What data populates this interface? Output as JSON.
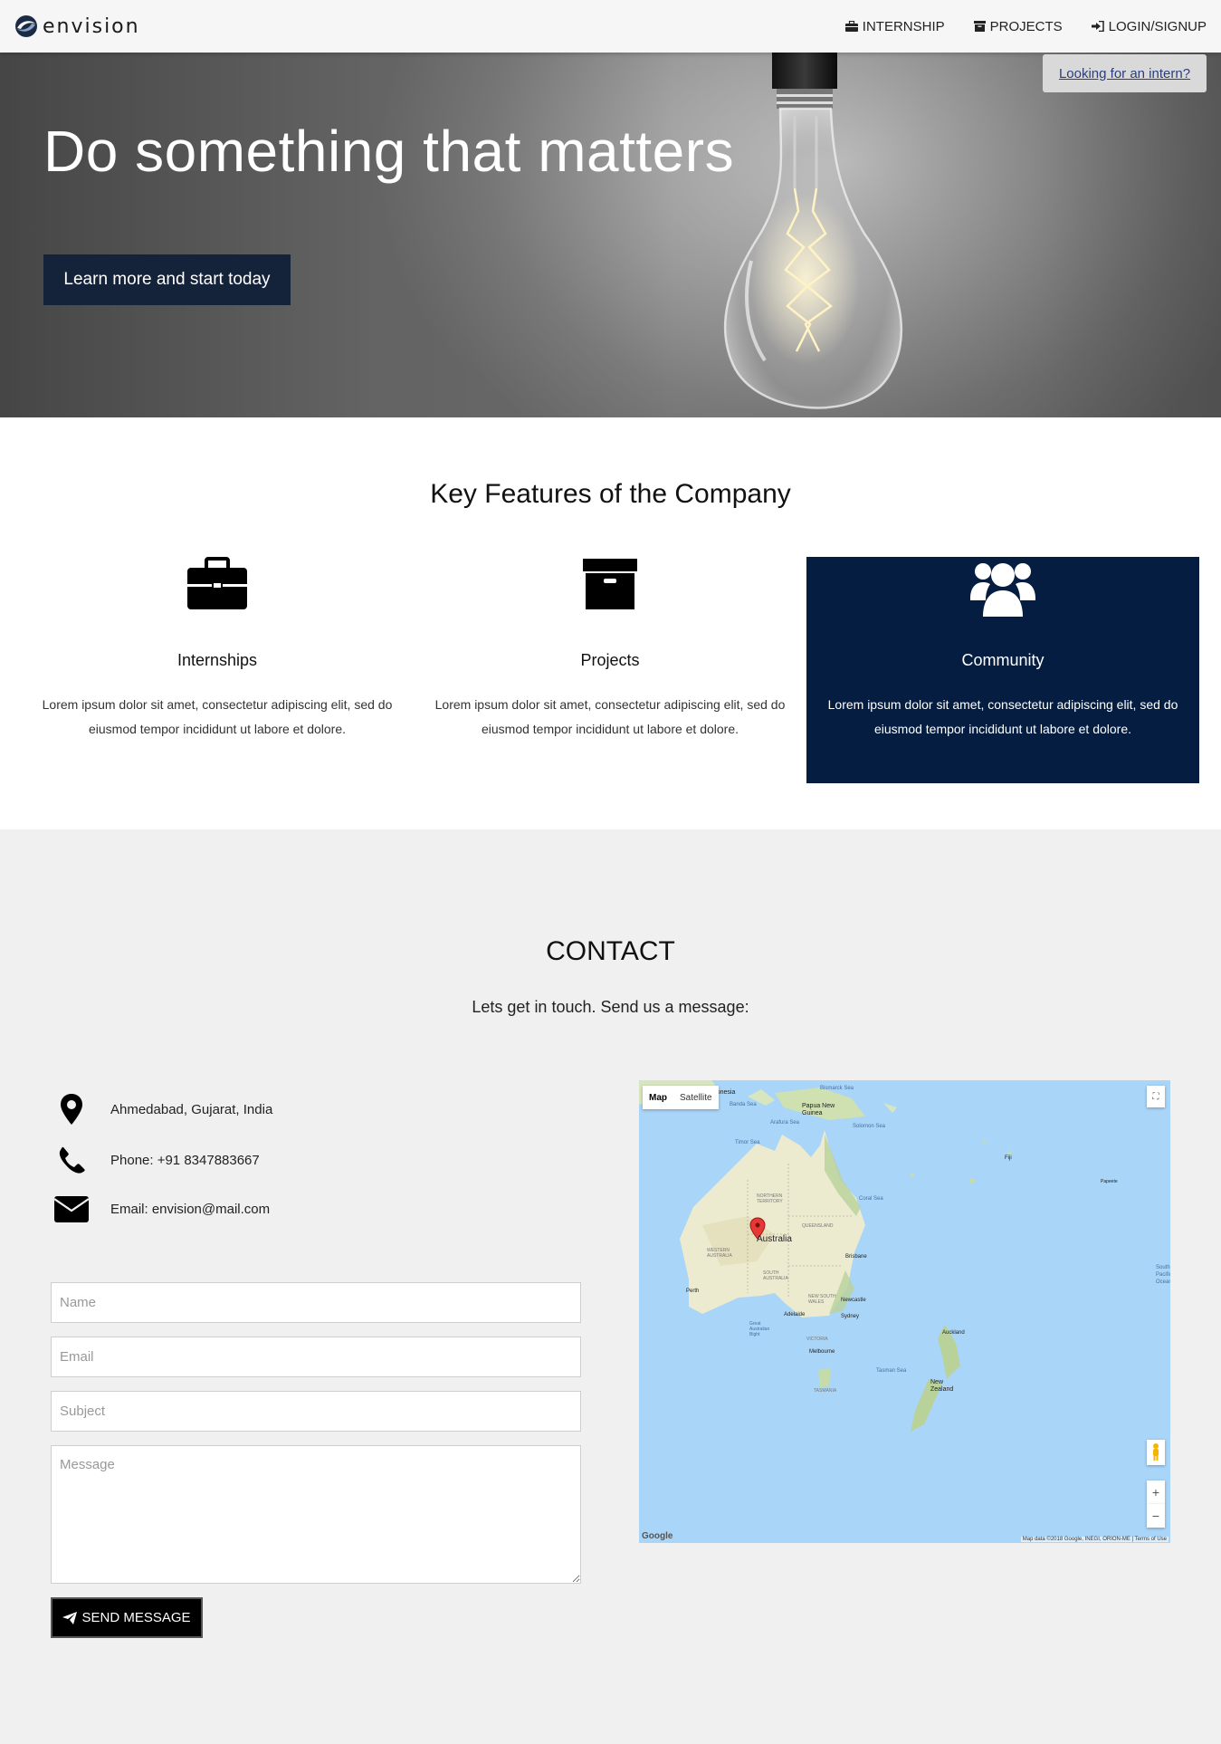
{
  "navbar": {
    "brand": "envision",
    "links": [
      {
        "label": "INTERNSHIP",
        "icon": "briefcase-icon"
      },
      {
        "label": "PROJECTS",
        "icon": "archive-icon"
      },
      {
        "label": "LOGIN/SIGNUP",
        "icon": "sign-in-icon"
      }
    ]
  },
  "hero": {
    "title": "Do something that matters",
    "cta_label": "Learn more and start today",
    "intern_link": "Looking for an intern?"
  },
  "features": {
    "title": "Key Features of the Company",
    "items": [
      {
        "name": "Internships",
        "icon": "briefcase-icon",
        "text": "Lorem ipsum dolor sit amet, consectetur adipiscing elit, sed do eiusmod tempor incididunt ut labore et dolore.",
        "highlighted": false
      },
      {
        "name": "Projects",
        "icon": "archive-icon",
        "text": "Lorem ipsum dolor sit amet, consectetur adipiscing elit, sed do eiusmod tempor incididunt ut labore et dolore.",
        "highlighted": false
      },
      {
        "name": "Community",
        "icon": "users-icon",
        "text": "Lorem ipsum dolor sit amet, consectetur adipiscing elit, sed do eiusmod tempor incididunt ut labore et dolore.",
        "highlighted": true
      }
    ]
  },
  "contact": {
    "title": "CONTACT",
    "subtitle": "Lets get in touch. Send us a message:",
    "address": "Ahmedabad, Gujarat, India",
    "phone": "Phone: +91 8347883667",
    "email": "Email: envision@mail.com",
    "form": {
      "name_placeholder": "Name",
      "email_placeholder": "Email",
      "subject_placeholder": "Subject",
      "message_placeholder": "Message",
      "send_label": "SEND MESSAGE"
    }
  },
  "map": {
    "type_options": [
      "Map",
      "Satellite"
    ],
    "selected_type": "Map",
    "labels": {
      "indonesia": "Indonesia",
      "banda_sea": "Banda Sea",
      "bismarck_sea": "Bismarck Sea",
      "png": "Papua New Guinea",
      "arafura": "Arafura Sea",
      "solomon": "Solomon Sea",
      "timor": "Timor Sea",
      "nt": "NORTHERN TERRITORY",
      "qld": "QUEENSLAND",
      "coral": "Coral Sea",
      "wa": "WESTERN AUSTRALIA",
      "australia": "Australia",
      "sa": "SOUTH AUSTRALIA",
      "nsw": "NEW SOUTH WALES",
      "brisbane": "Brisbane",
      "perth": "Perth",
      "adelaide": "Adelaide",
      "sydney": "Sydney",
      "newcastle": "Newcastle",
      "bight": "Great Australian Bight",
      "victoria": "VICTORIA",
      "melbourne": "Melbourne",
      "tasman": "Tasman Sea",
      "tasmania": "TASMANIA",
      "auckland": "Auckland",
      "nz": "New Zealand",
      "fiji": "Fiji",
      "papeete": "Papeete",
      "south_pacific": "South Pacific Ocean"
    },
    "footer": "Map data ©2018 Google, INEGI, ORION-ME | Terms of Use",
    "logo": "Google",
    "zoom_in": "+",
    "zoom_out": "−"
  }
}
